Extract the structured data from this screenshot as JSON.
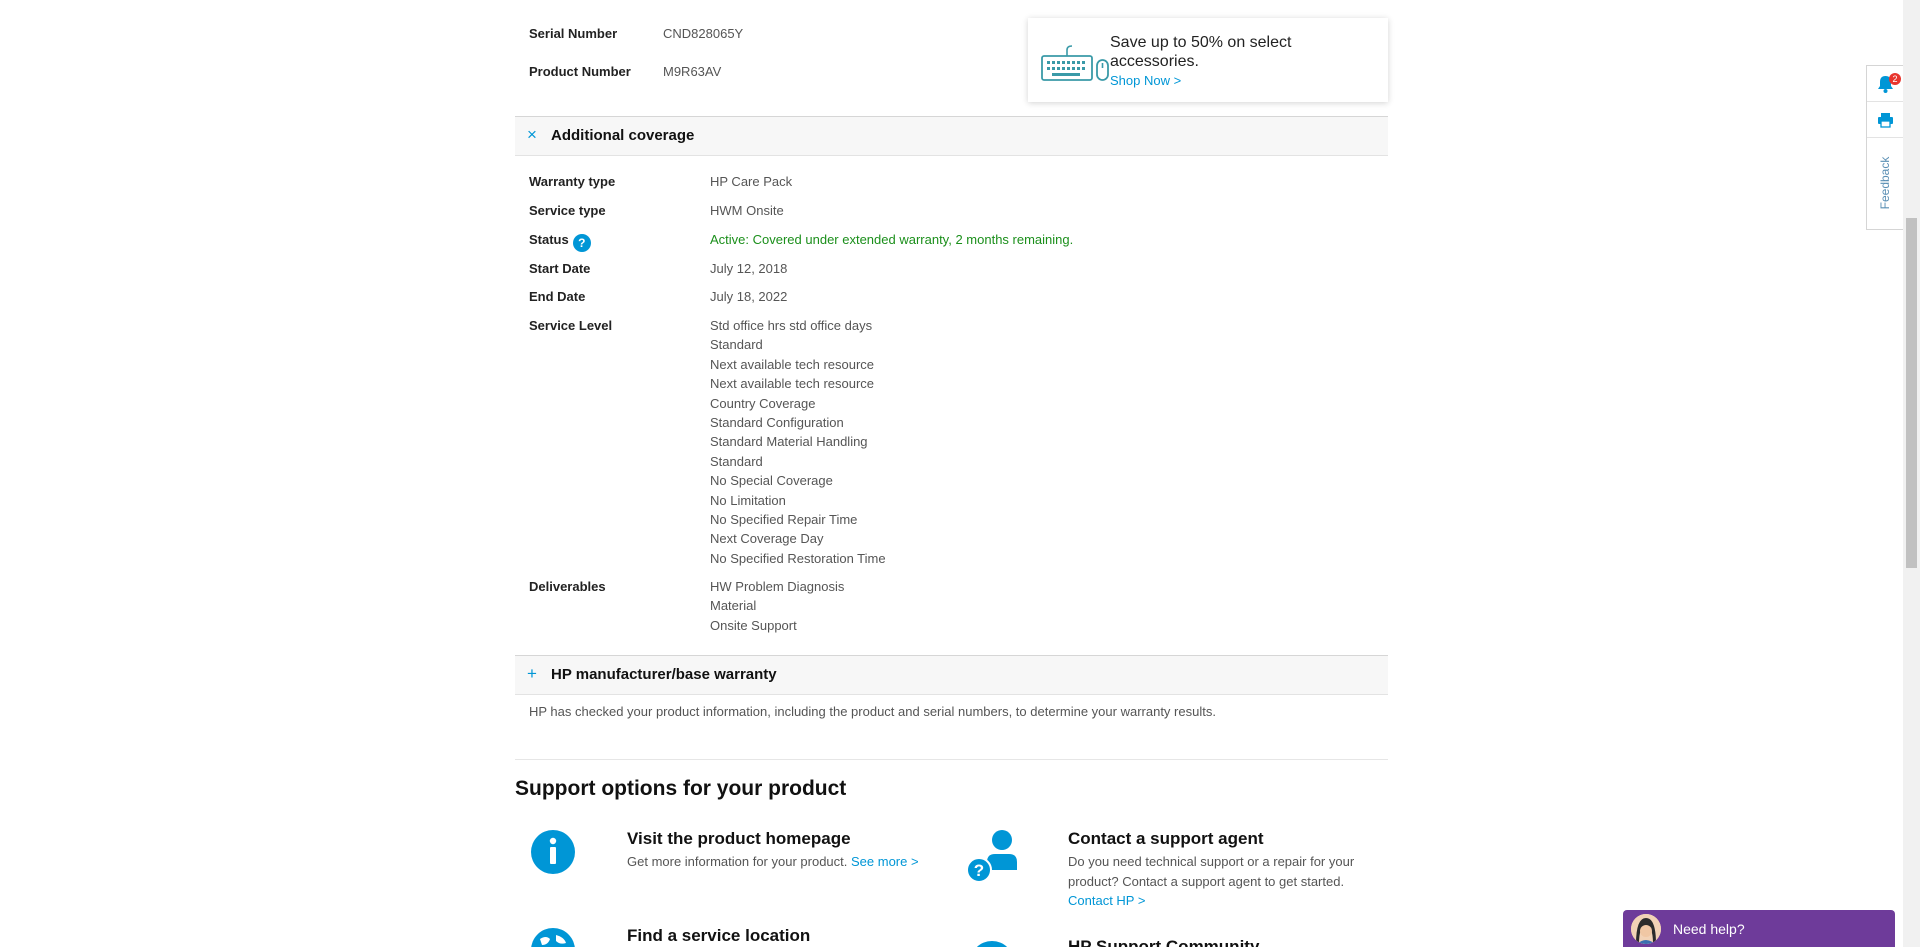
{
  "product": {
    "serial_label": "Serial Number",
    "serial_value": "CND828065Y",
    "product_label": "Product Number",
    "product_value": "M9R63AV"
  },
  "promo": {
    "title": "Save up to 50% on select accessories.",
    "link": "Shop Now >",
    "icon": "keyboard-mouse-icon"
  },
  "additional_coverage": {
    "toggle": "×",
    "title": "Additional coverage",
    "rows": {
      "warranty_type": {
        "label": "Warranty type",
        "value": "HP Care Pack"
      },
      "service_type": {
        "label": "Service type",
        "value": "HWM Onsite"
      },
      "status": {
        "label": "Status",
        "help": "?",
        "value": "Active: Covered under extended warranty, 2 months remaining.",
        "value_color": "#1b8f1b"
      },
      "start_date": {
        "label": "Start Date",
        "value": "July 12, 2018"
      },
      "end_date": {
        "label": "End Date",
        "value": "July 18, 2022"
      },
      "service_level": {
        "label": "Service Level",
        "values": [
          "Std office hrs std office days",
          "Standard",
          "Next available tech resource",
          "Next available tech resource",
          "Country Coverage",
          "Standard Configuration",
          "Standard Material Handling",
          "Standard",
          "No Special Coverage",
          "No Limitation",
          "No Specified Repair Time",
          "Next Coverage Day",
          "No Specified Restoration Time"
        ]
      },
      "deliverables": {
        "label": "Deliverables",
        "values": [
          "HW Problem Diagnosis",
          "Material",
          "Onsite Support"
        ]
      }
    }
  },
  "base_warranty": {
    "toggle": "+",
    "title": "HP manufacturer/base warranty"
  },
  "note": "HP has checked your product information, including the product and serial numbers, to determine your warranty results.",
  "support": {
    "title": "Support options for your product",
    "options": [
      {
        "title": "Visit the product homepage",
        "text": "Get more information for your product.",
        "link": "See more >",
        "icon": "info-icon"
      },
      {
        "title": "Contact a support agent",
        "text": "Do you need technical support or a repair for your product? Contact a support agent to get started.",
        "link": "Contact HP >",
        "icon": "support-agent-icon"
      },
      {
        "title": "Find a service location",
        "icon": "globe-icon"
      },
      {
        "title": "HP Support Community",
        "icon": "community-icon"
      }
    ]
  },
  "side_rail": {
    "notification_count": "2",
    "feedback": "Feedback"
  },
  "chat": {
    "label": "Need help?"
  },
  "colors": {
    "accent": "#0096d6",
    "status_green": "#1b8f1b",
    "chat_purple": "#6e3b9a"
  }
}
